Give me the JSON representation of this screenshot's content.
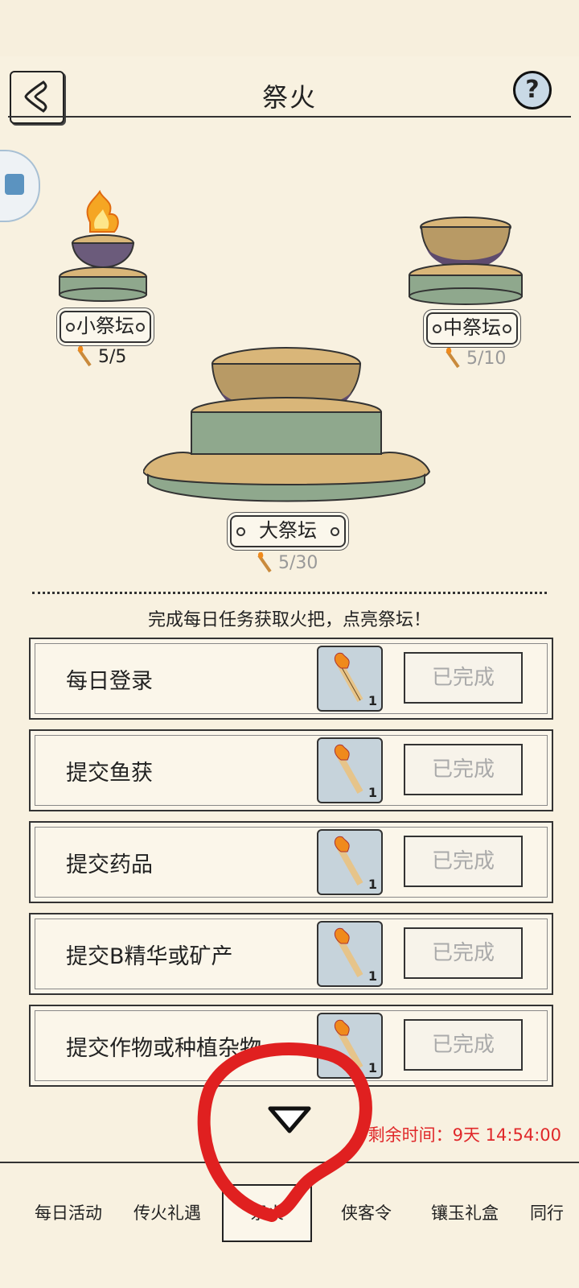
{
  "header": {
    "title": "祭火",
    "back_icon": "back-arrow-icon",
    "help_label": "?"
  },
  "altars": {
    "small": {
      "label": "小祭坛",
      "count": "5/5",
      "lit": true
    },
    "medium": {
      "label": "中祭坛",
      "count": "5/10",
      "lit": false
    },
    "large": {
      "label": "大祭坛",
      "count": "5/30",
      "lit": false
    }
  },
  "hint": "完成每日任务获取火把，点亮祭坛！",
  "tasks": [
    {
      "label": "每日登录",
      "reward_qty": "1",
      "status": "已完成"
    },
    {
      "label": "提交鱼获",
      "reward_qty": "1",
      "status": "已完成"
    },
    {
      "label": "提交药品",
      "reward_qty": "1",
      "status": "已完成"
    },
    {
      "label": "提交B精华或矿产",
      "reward_qty": "1",
      "status": "已完成"
    },
    {
      "label": "提交作物或种植杂物",
      "reward_qty": "1",
      "status": "已完成"
    }
  ],
  "remaining_time": "剩余时间：9天 14:54:00",
  "tabs": [
    "每日活动",
    "传火礼遇",
    "祭火",
    "侠客令",
    "镶玉礼盒",
    "同行"
  ],
  "active_tab": "祭火",
  "colors": {
    "background": "#f8f1e0",
    "timer": "#e0282a",
    "annotation": "#e02020"
  }
}
